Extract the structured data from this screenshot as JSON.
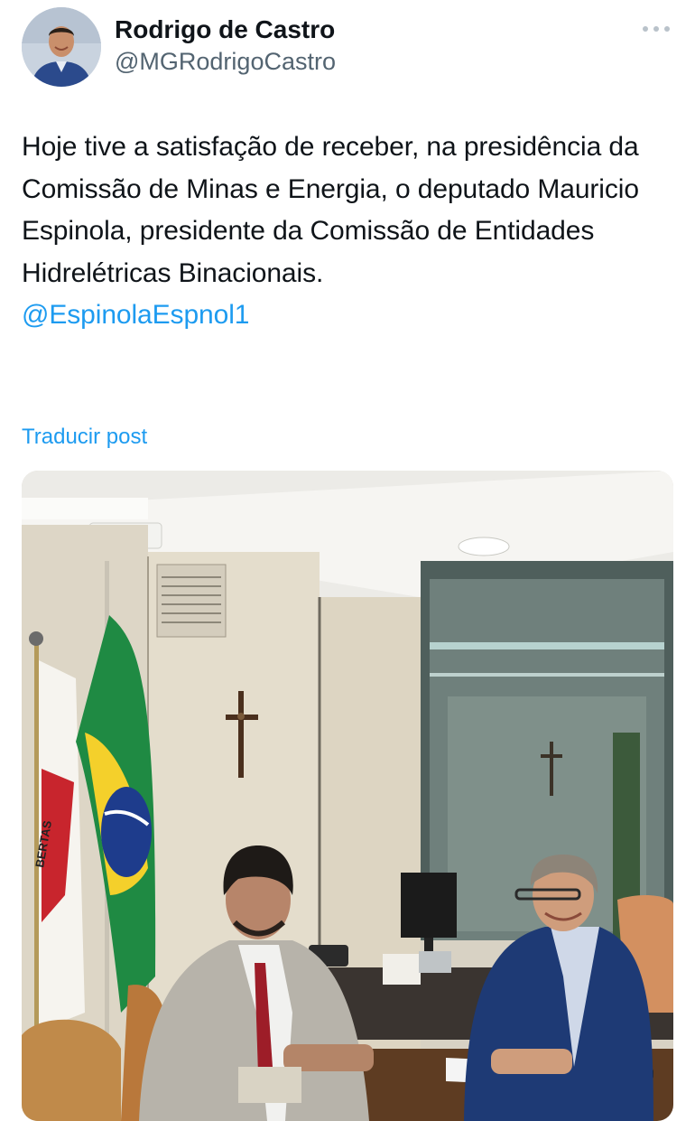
{
  "author": {
    "display_name": "Rodrigo de Castro",
    "handle": "@MGRodrigoCastro",
    "avatar_icon": "user-photo-avatar"
  },
  "header": {
    "more_icon": "more-options-icon"
  },
  "tweet": {
    "text": "Hoje tive a satisfação de receber, na presidência da Comissão de Minas e Energia, o deputado Mauricio Espinola, presidente da Comissão de Entidades Hidrelétricas Binacionais.",
    "mention": "@EspinolaEspnol1",
    "translate_label": "Traducir post"
  },
  "media": {
    "flag_text": "BERTAS"
  },
  "colors": {
    "link": "#1d9bf0",
    "text": "#0f1419",
    "secondary": "#536471"
  }
}
